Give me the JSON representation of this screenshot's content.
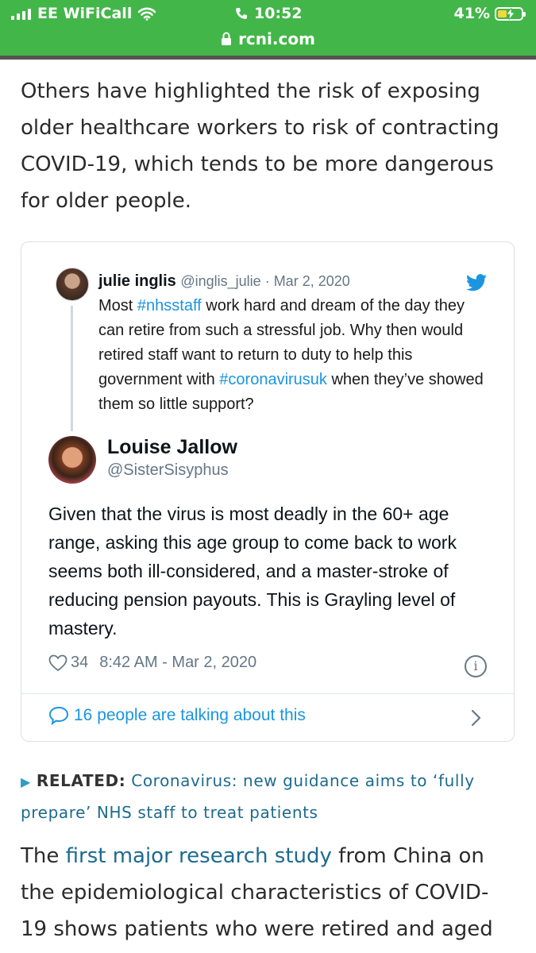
{
  "status_bar": {
    "carrier": "EE WiFiCall",
    "time": "10:52",
    "battery": "41%",
    "battery_level": 0.41
  },
  "url_bar": {
    "domain": "rcni.com"
  },
  "article": {
    "paragraph1": "Others have highlighted the risk of exposing older healthcare workers to risk of contracting COVID-19, which tends to be more dangerous for older people.",
    "related_label": "RELATED:",
    "related_link": "Coronavirus: new guidance aims to ‘fully prepare’ NHS staff to treat patients",
    "p2_before": "The ",
    "p2_link": "first major research study",
    "p2_after": " from China on the epidemiological characteristics of COVID-19 shows patients who were retired and aged"
  },
  "tweet": {
    "quoted": {
      "name": "julie inglis",
      "handle": "@inglis_julie",
      "sep": " · ",
      "date": "Mar 2, 2020",
      "t1": "Most ",
      "hashtag1": "#nhsstaff",
      "t2": " work hard and dream of the day they can retire from such a stressful job. Why then would retired staff want to return to duty to help this government with ",
      "hashtag2": "#coronavirusuk",
      "t3": " when they’ve  showed them so little support?"
    },
    "author": {
      "name": "Louise Jallow",
      "handle": "@SisterSisyphus"
    },
    "text": "Given that the virus is most deadly in the 60+ age range, asking this age group to come back to work seems both ill-considered, and a master-stroke of reducing pension payouts. This is Grayling level of mastery.",
    "likes": "34",
    "timestamp": "8:42 AM - Mar 2, 2020",
    "info_glyph": "i",
    "talking": "16 people are talking about this"
  },
  "colors": {
    "status_green": "#43b649",
    "twitter_blue": "#1b95e0",
    "link_blue": "#1c6b8e",
    "muted_gray": "#657786"
  }
}
